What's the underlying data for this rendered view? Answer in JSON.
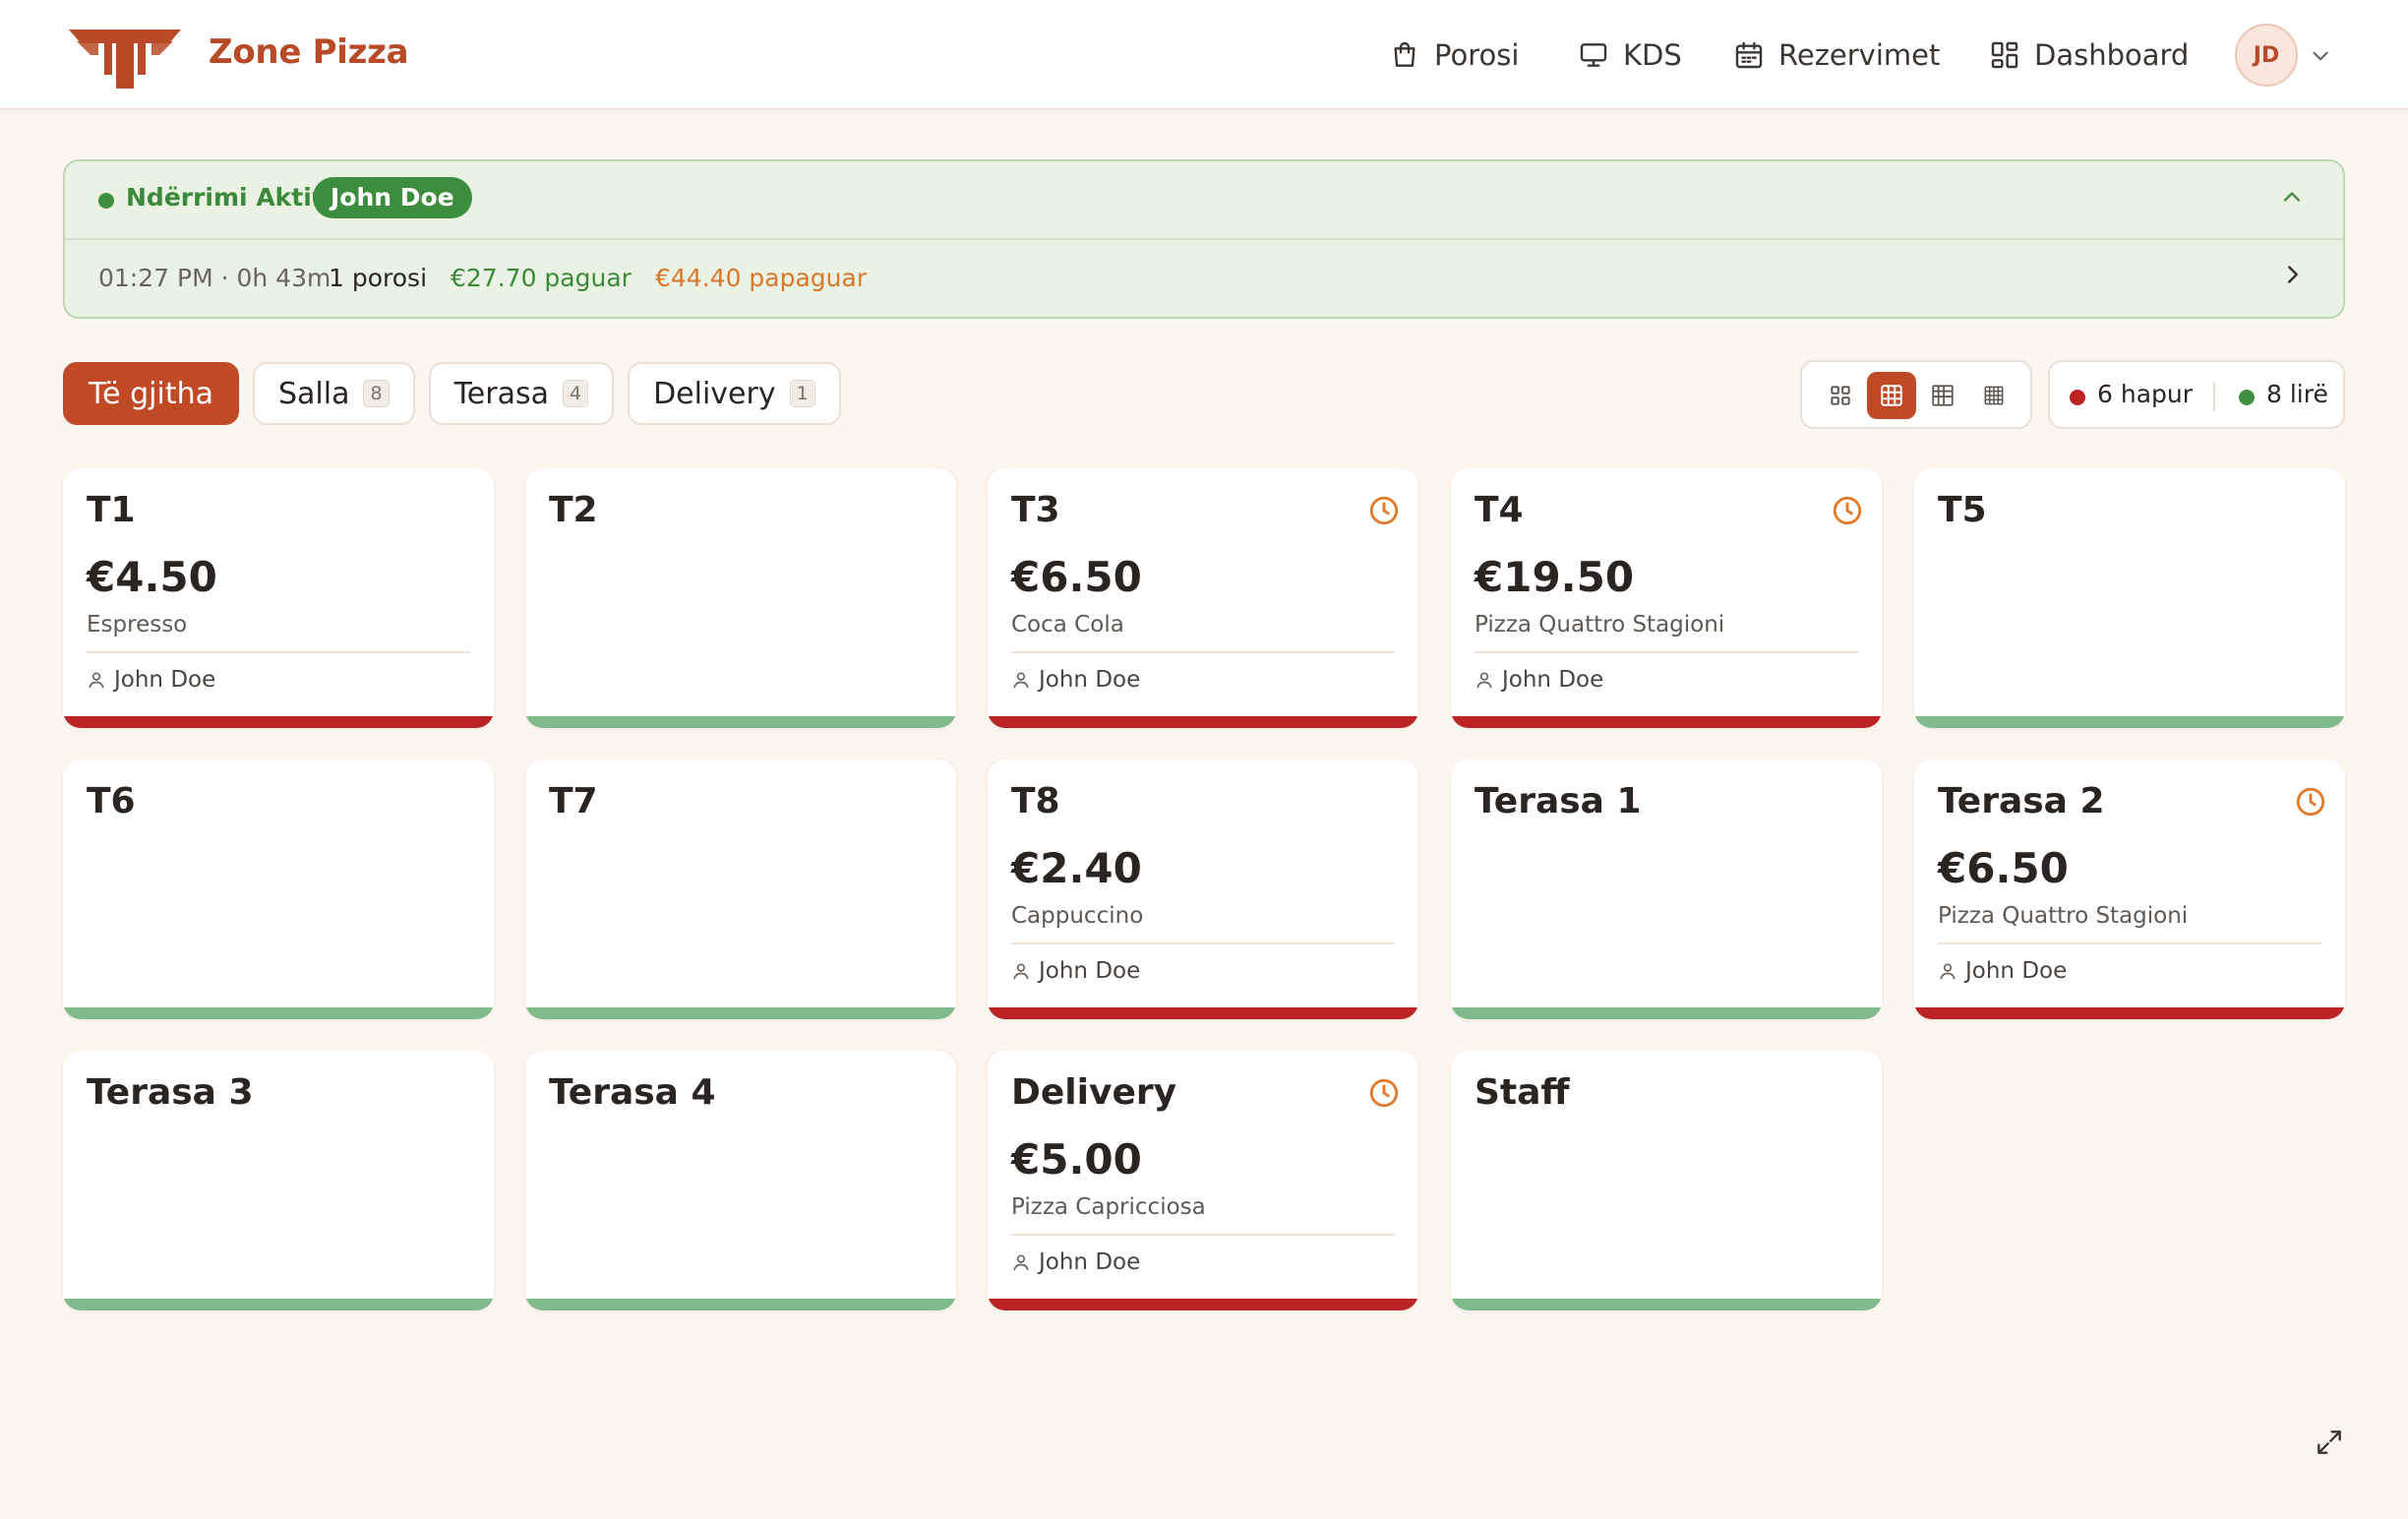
{
  "brand": {
    "name": "Zone Pizza",
    "color": "#b84a28"
  },
  "nav": [
    {
      "label": "Porosi",
      "icon": "shopping-bag-icon"
    },
    {
      "label": "KDS",
      "icon": "monitor-icon"
    },
    {
      "label": "Rezervimet",
      "icon": "calendar-icon"
    },
    {
      "label": "Dashboard",
      "icon": "dashboard-icon"
    }
  ],
  "user": {
    "initials": "JD"
  },
  "shift": {
    "status": "Ndërrimi Aktiv",
    "user": "John Doe",
    "time": "01:27 PM · 0h 43m",
    "orders": "1 porosi",
    "paid": "€27.70 paguar",
    "unpaid": "€44.40 papaguar"
  },
  "tabs": [
    {
      "label": "Të gjitha",
      "count": ""
    },
    {
      "label": "Salla",
      "count": "8"
    },
    {
      "label": "Terasa",
      "count": "4"
    },
    {
      "label": "Delivery",
      "count": "1"
    }
  ],
  "status_summary": {
    "open": "6 hapur",
    "free": "8 lirë",
    "open_color": "#bb2424",
    "free_color": "#3e8f3e"
  },
  "tables": [
    {
      "name": "T1",
      "amount": "€4.50",
      "item": "Espresso",
      "user": "John Doe",
      "state": "open",
      "clock": false
    },
    {
      "name": "T2",
      "amount": "",
      "item": "",
      "user": "",
      "state": "free",
      "clock": false
    },
    {
      "name": "T3",
      "amount": "€6.50",
      "item": "Coca Cola",
      "user": "John Doe",
      "state": "open",
      "clock": true
    },
    {
      "name": "T4",
      "amount": "€19.50",
      "item": "Pizza Quattro Stagioni",
      "user": "John Doe",
      "state": "open",
      "clock": true
    },
    {
      "name": "T5",
      "amount": "",
      "item": "",
      "user": "",
      "state": "free",
      "clock": false
    },
    {
      "name": "T6",
      "amount": "",
      "item": "",
      "user": "",
      "state": "free",
      "clock": false
    },
    {
      "name": "T7",
      "amount": "",
      "item": "",
      "user": "",
      "state": "free",
      "clock": false
    },
    {
      "name": "T8",
      "amount": "€2.40",
      "item": "Cappuccino",
      "user": "John Doe",
      "state": "open",
      "clock": false
    },
    {
      "name": "Terasa 1",
      "amount": "",
      "item": "",
      "user": "",
      "state": "free",
      "clock": false
    },
    {
      "name": "Terasa 2",
      "amount": "€6.50",
      "item": "Pizza Quattro Stagioni",
      "user": "John Doe",
      "state": "open",
      "clock": true
    },
    {
      "name": "Terasa 3",
      "amount": "",
      "item": "",
      "user": "",
      "state": "free",
      "clock": false
    },
    {
      "name": "Terasa 4",
      "amount": "",
      "item": "",
      "user": "",
      "state": "free",
      "clock": false
    },
    {
      "name": "Delivery",
      "amount": "€5.00",
      "item": "Pizza Capricciosa",
      "user": "John Doe",
      "state": "open",
      "clock": true
    },
    {
      "name": "Staff",
      "amount": "",
      "item": "",
      "user": "",
      "state": "free",
      "clock": false
    }
  ]
}
